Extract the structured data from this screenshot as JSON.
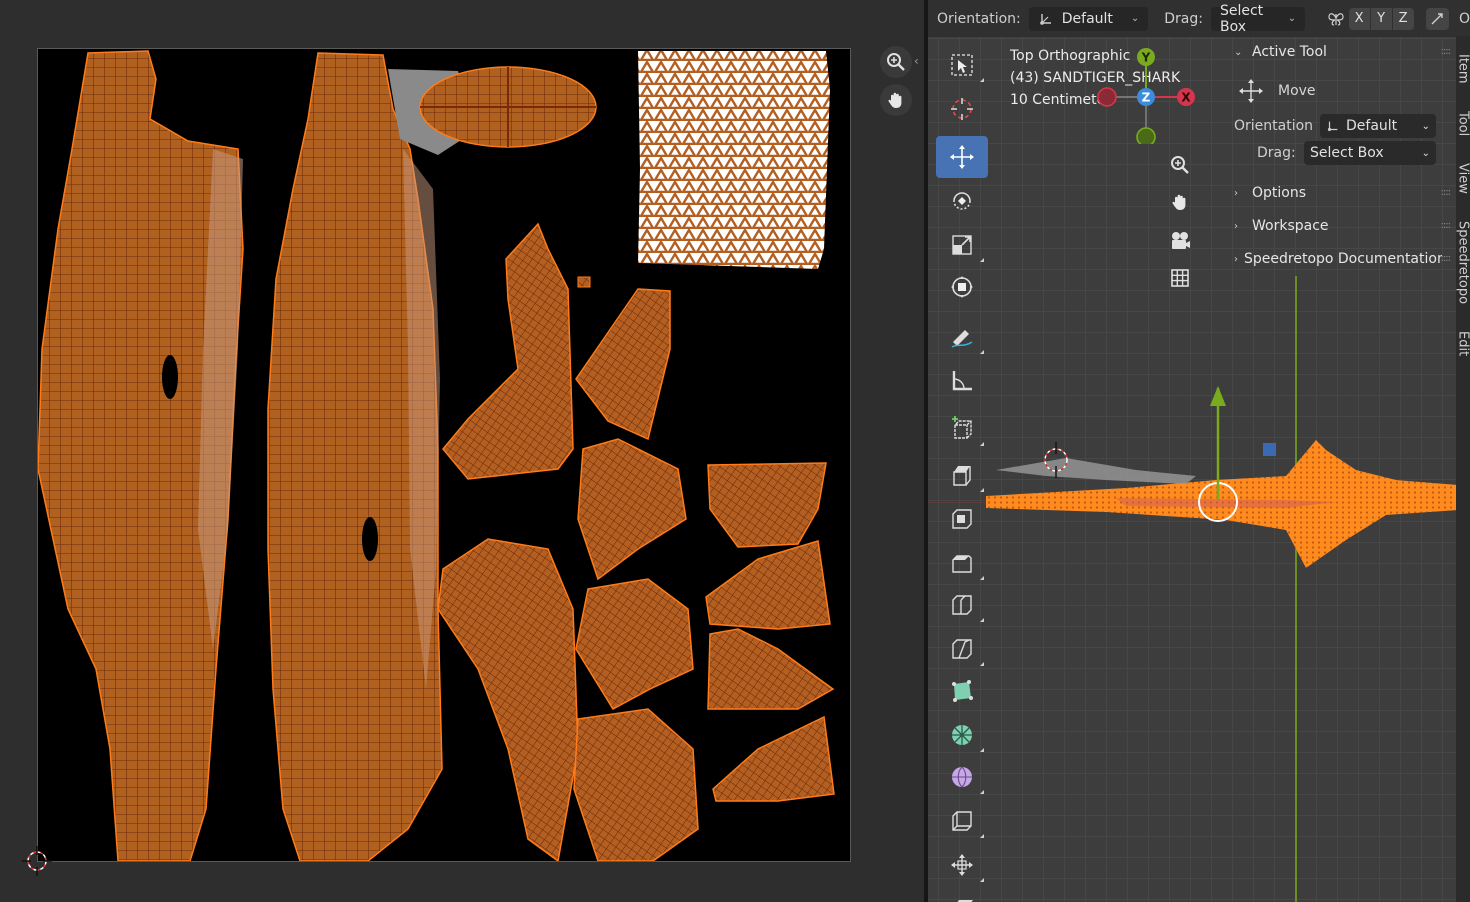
{
  "header": {
    "orientation_label": "Orientation:",
    "orientation_value": "Default",
    "drag_label": "Drag:",
    "drag_value": "Select Box",
    "axes": [
      "X",
      "Y",
      "Z"
    ],
    "corner_text": "O"
  },
  "viewport_info": {
    "view": "Top Orthographic",
    "object": "(43) SANDTIGER_SHARK",
    "scale": "10 Centimeters"
  },
  "gizmo": {
    "y": "Y",
    "z": "Z",
    "x": "X"
  },
  "npanel": {
    "active_tool": {
      "title": "Active Tool",
      "tool_name": "Move",
      "orientation_label": "Orientation",
      "orientation_value": "Default",
      "drag_label": "Drag:",
      "drag_value": "Select Box"
    },
    "sections": [
      "Options",
      "Workspace",
      "Speedretopo Documentation"
    ]
  },
  "side_tabs": [
    "Item",
    "Tool",
    "View",
    "Speedretopo",
    "Edit"
  ],
  "toolbar": [
    "select-box-icon",
    "cursor-icon",
    "move-icon",
    "rotate-icon",
    "scale-icon",
    "transform-icon",
    "annotate-icon",
    "measure-icon",
    "add-cube-icon",
    "extrude-icon",
    "inset-icon",
    "bevel-icon",
    "loop-cut-icon",
    "knife-icon",
    "poly-build-icon",
    "spin-icon",
    "smooth-icon",
    "edge-slide-icon",
    "shrink-fatten-icon",
    "shear-icon"
  ],
  "colors": {
    "accent": "#4772b3",
    "uv_island": "#b35f22",
    "mesh_selected": "#ff8a1e",
    "axis_x": "#d6364d",
    "axis_y": "#7aaa1e",
    "axis_z": "#3b8cdc"
  }
}
